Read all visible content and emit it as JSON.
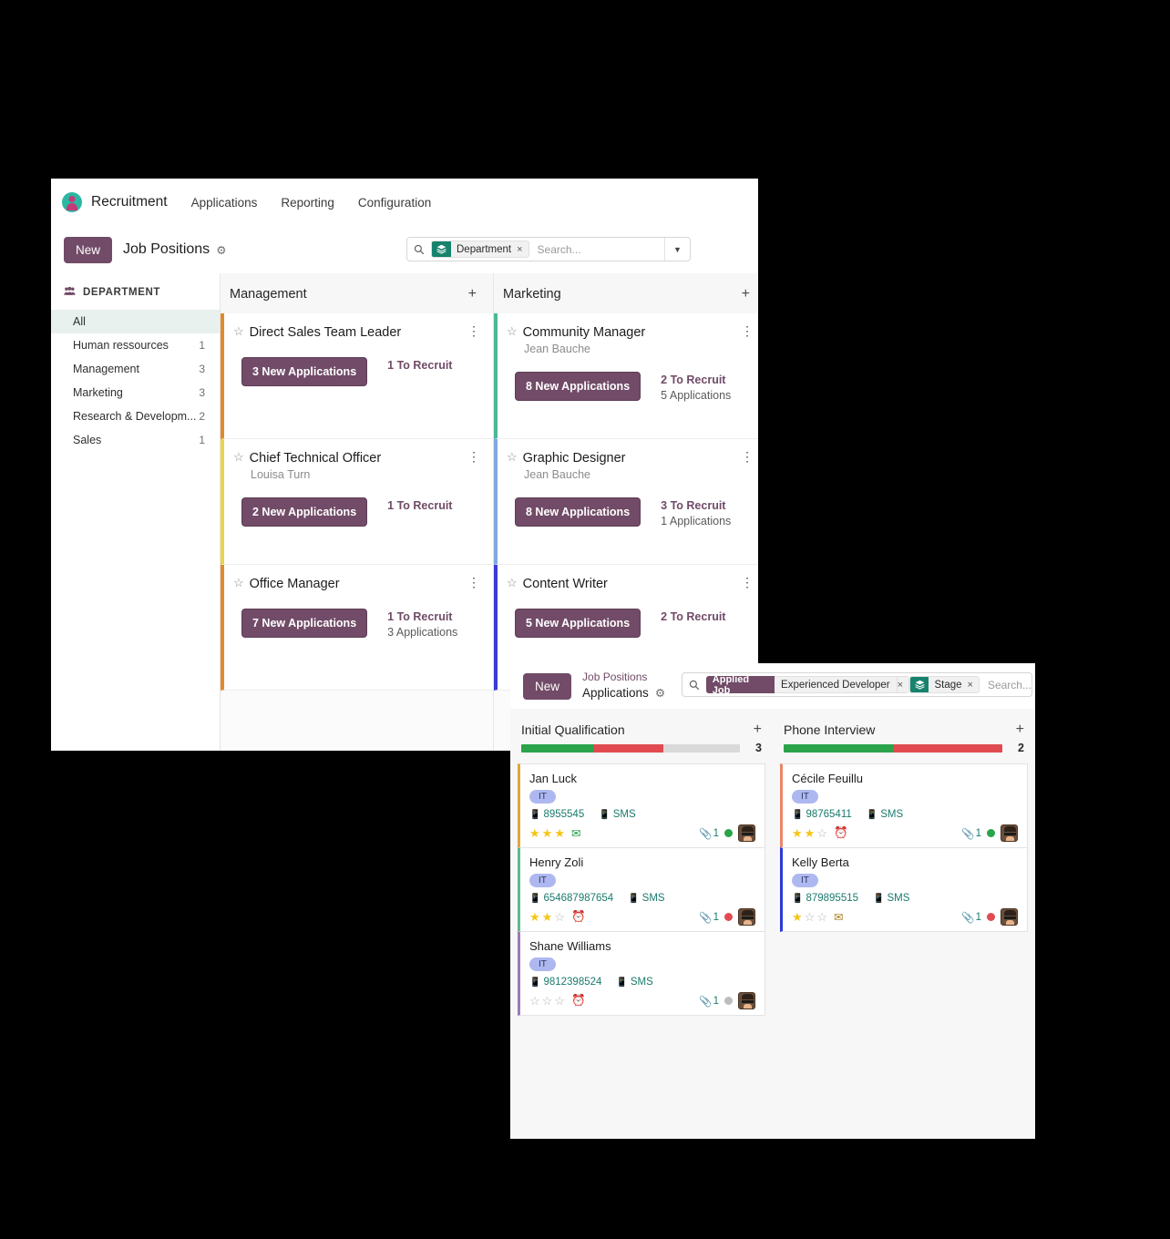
{
  "window1": {
    "topnav": {
      "brand": "Recruitment",
      "items": [
        {
          "label": "Applications"
        },
        {
          "label": "Reporting"
        },
        {
          "label": "Configuration"
        }
      ]
    },
    "controlbar": {
      "new_label": "New",
      "breadcrumb": "Job Positions",
      "gear_icon": "gear-icon"
    },
    "search": {
      "facet_icon": "layers-icon",
      "facet_label": "Department",
      "facet_remove": "×",
      "placeholder": "Search...",
      "caret": "▼"
    },
    "sidebar": {
      "heading": "DEPARTMENT",
      "heading_icon": "people-icon",
      "items": [
        {
          "label": "All",
          "count": ""
        },
        {
          "label": "Human ressources",
          "count": "1"
        },
        {
          "label": "Management",
          "count": "3"
        },
        {
          "label": "Marketing",
          "count": "3"
        },
        {
          "label": "Research & Developm...",
          "count": "2"
        },
        {
          "label": "Sales",
          "count": "1"
        }
      ]
    },
    "columns": [
      {
        "title": "Management",
        "add_icon": "plus-icon",
        "cards": [
          {
            "title": "Direct Sales Team Leader",
            "recruiter": "",
            "button": "3 New Applications",
            "to_recruit": "1 To Recruit",
            "applications": "",
            "accent": "#e08a2e"
          },
          {
            "title": "Chief Technical Officer",
            "recruiter": "Louisa Turn",
            "button": "2 New Applications",
            "to_recruit": "1 To Recruit",
            "applications": "",
            "accent": "#e8d44d"
          },
          {
            "title": "Office Manager",
            "recruiter": "",
            "button": "7 New Applications",
            "to_recruit": "1 To Recruit",
            "applications": "3 Applications",
            "accent": "#e08a2e"
          }
        ]
      },
      {
        "title": "Marketing",
        "add_icon": "plus-icon",
        "cards": [
          {
            "title": "Community Manager",
            "recruiter": "Jean Bauche",
            "button": "8 New Applications",
            "to_recruit": "2 To Recruit",
            "applications": "5 Applications",
            "accent": "#4db898"
          },
          {
            "title": "Graphic Designer",
            "recruiter": "Jean Bauche",
            "button": "8 New Applications",
            "to_recruit": "3 To Recruit",
            "applications": "1 Applications",
            "accent": "#7fa8e0"
          },
          {
            "title": "Content Writer",
            "recruiter": "",
            "button": "5 New Applications",
            "to_recruit": "2 To Recruit",
            "applications": "",
            "accent": "#3b3bd6"
          }
        ]
      }
    ]
  },
  "window2": {
    "controlbar": {
      "new_label": "New",
      "breadcrumb_top": "Job Positions",
      "breadcrumb_bottom": "Applications",
      "gear_icon": "gear-icon"
    },
    "search": {
      "facet_dark_label": "Applied Job",
      "facet_value": "Experienced Developer",
      "facet_value_remove": "×",
      "facet2_icon": "layers-icon",
      "facet2_label": "Stage",
      "facet2_remove": "×",
      "placeholder": "Search..."
    },
    "columns": [
      {
        "title": "Initial Qualification",
        "add_icon": "plus-icon",
        "count": "3",
        "meter": [
          {
            "color": "#2aa34a",
            "pct": 33
          },
          {
            "color": "#e04a50",
            "pct": 32
          },
          {
            "color": "#d9d9d9",
            "pct": 35
          }
        ],
        "cards": [
          {
            "name": "Jan Luck",
            "tag": "IT",
            "phone": "8955545",
            "sms": "SMS",
            "stars": 3,
            "status_icon": "envelope-icon",
            "status_icon_color": "#1f9c4a",
            "attachments": "1",
            "dot_color": "#2aa34a",
            "accent": "#e0a63c",
            "avatar": "avatar"
          },
          {
            "name": "Henry Zoli",
            "tag": "IT",
            "phone": "654687987654",
            "sms": "SMS",
            "stars": 2,
            "status_icon": "clock-icon",
            "status_icon_color": "#3a3a3a",
            "attachments": "1",
            "dot_color": "#e04a50",
            "accent": "#5fba8a",
            "avatar": "avatar"
          },
          {
            "name": "Shane Williams",
            "tag": "IT",
            "phone": "9812398524",
            "sms": "SMS",
            "stars": 0,
            "status_icon": "clock-icon",
            "status_icon_color": "#3a3a3a",
            "attachments": "1",
            "dot_color": "#bdbdbd",
            "accent": "#9b7bb5",
            "avatar": "avatar"
          }
        ]
      },
      {
        "title": "Phone Interview",
        "add_icon": "plus-icon",
        "count": "2",
        "meter": [
          {
            "color": "#2aa34a",
            "pct": 50
          },
          {
            "color": "#e04a50",
            "pct": 50
          }
        ],
        "cards": [
          {
            "name": "Cécile Feuillu",
            "tag": "IT",
            "phone": "98765411",
            "sms": "SMS",
            "stars": 2,
            "status_icon": "clock-icon",
            "status_icon_color": "#3a3a3a",
            "attachments": "1",
            "dot_color": "#2aa34a",
            "accent": "#e8876a",
            "avatar": "avatar"
          },
          {
            "name": "Kelly Berta",
            "tag": "IT",
            "phone": "879895515",
            "sms": "SMS",
            "stars": 1,
            "status_icon": "envelope-icon",
            "status_icon_color": "#a8801f",
            "attachments": "1",
            "dot_color": "#e04a50",
            "accent": "#2b3ad6",
            "avatar": "avatar"
          }
        ]
      }
    ]
  }
}
